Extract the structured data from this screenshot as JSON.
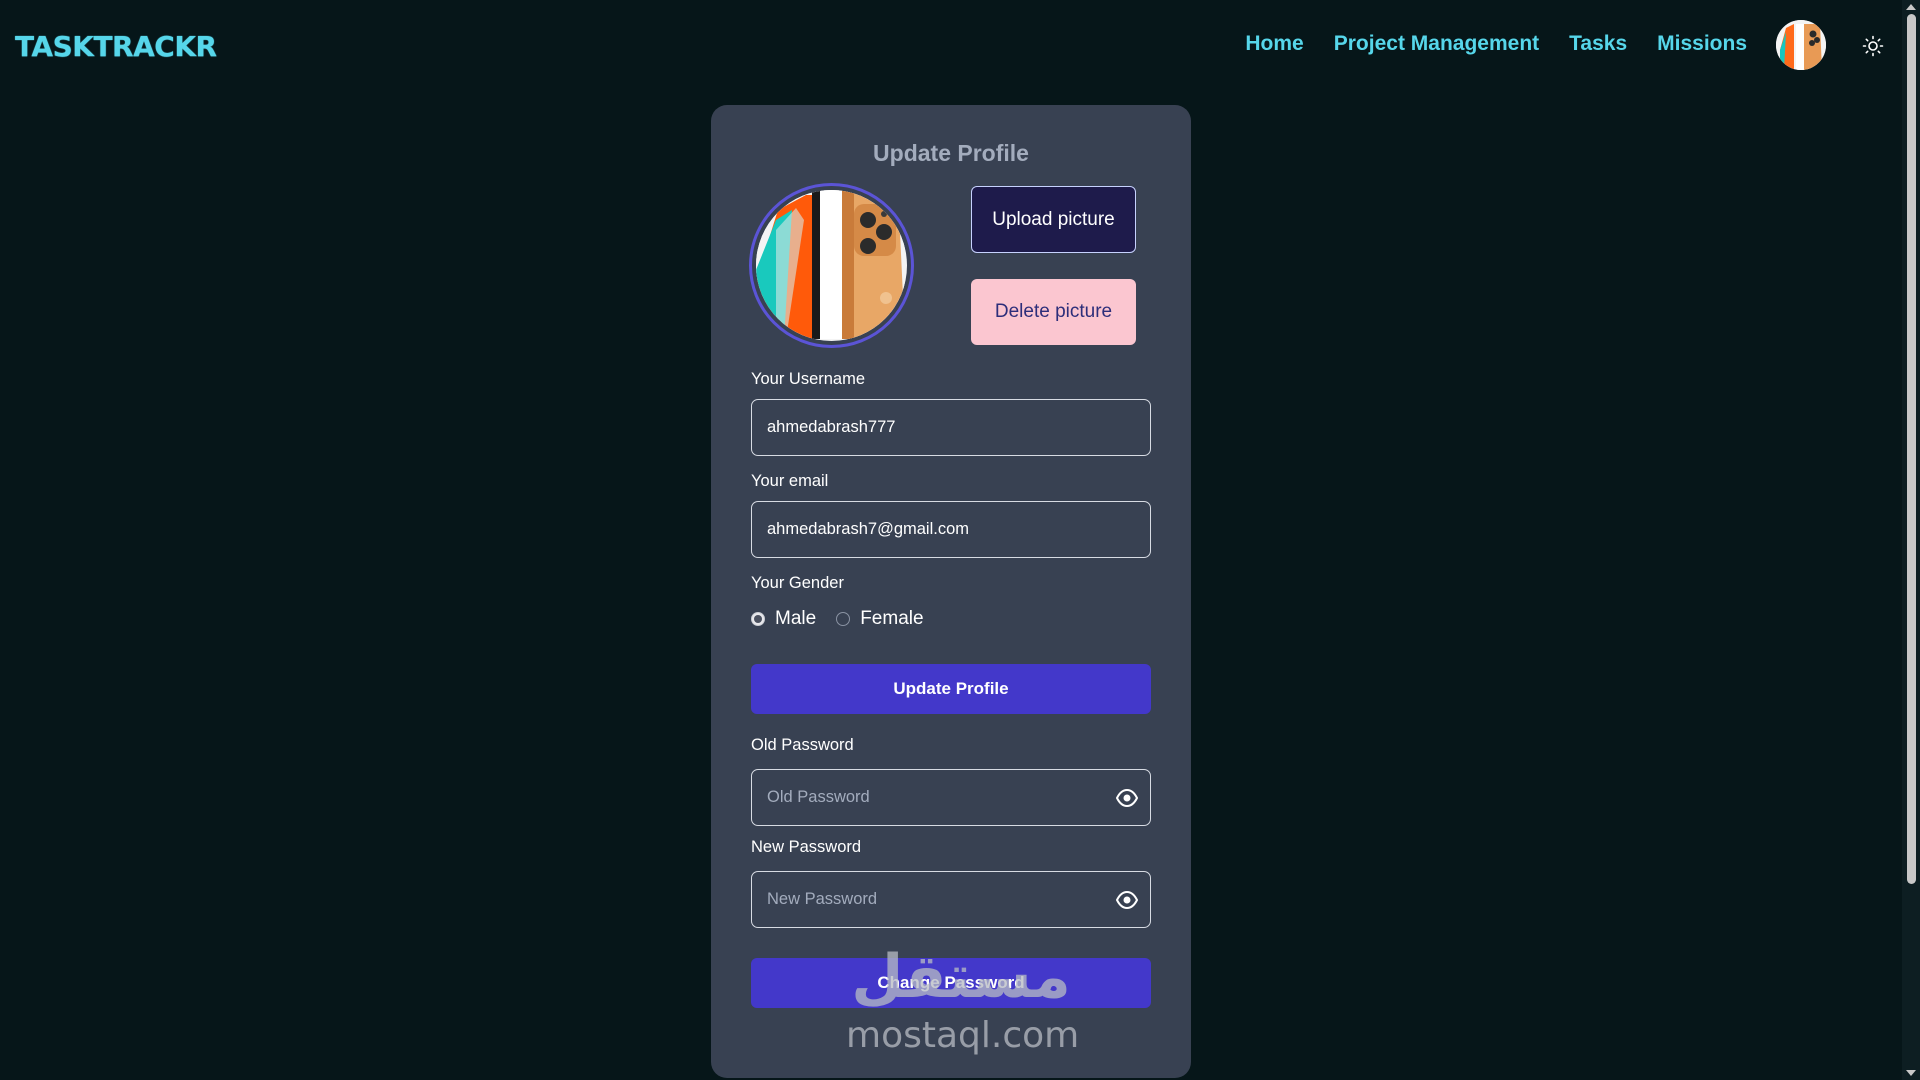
{
  "header": {
    "brand": "TASKTRACKR",
    "nav": [
      "Home",
      "Project Management",
      "Tasks",
      "Missions"
    ]
  },
  "profile": {
    "title": "Update Profile",
    "upload_label": "Upload picture",
    "delete_label": "Delete picture",
    "username_label": "Your Username",
    "username_value": "ahmedabrash777",
    "email_label": "Your email",
    "email_value": "ahmedabrash7@gmail.com",
    "gender_label": "Your Gender",
    "gender_options": [
      "Male",
      "Female"
    ],
    "gender_selected": "Male",
    "update_button": "Update Profile",
    "old_password_label": "Old Password",
    "old_password_placeholder": "Old Password",
    "new_password_label": "New Password",
    "new_password_placeholder": "New Password",
    "change_button": "Change Password"
  },
  "watermark": {
    "logo": "مستقل",
    "text": "mostaql.com"
  },
  "icons": {
    "theme": "sun-icon",
    "password_toggle": "eye-icon"
  },
  "colors": {
    "background": "#061619",
    "brand": "#56d6ea",
    "card": "#384152",
    "primary_button": "#4338ca",
    "upload_button": "#1e1b4b",
    "delete_button": "#fbc6d0"
  }
}
